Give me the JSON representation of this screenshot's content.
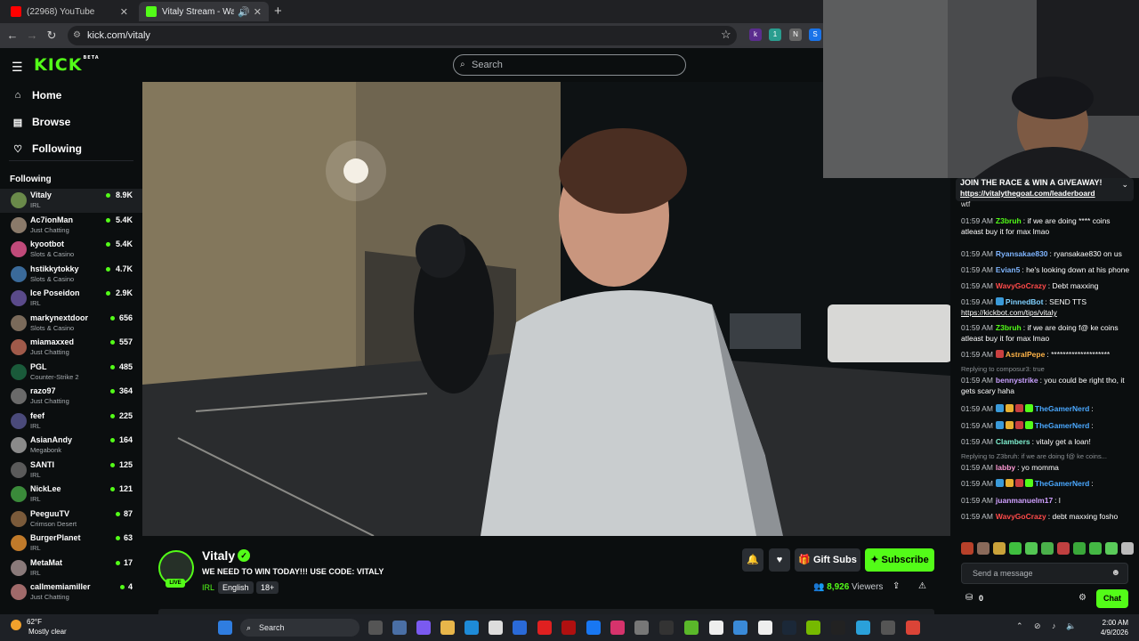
{
  "browser": {
    "tabs": [
      {
        "label": "(22968) YouTube"
      },
      {
        "label": "Vitaly Stream - Watch Live on Kick"
      }
    ],
    "url": "kick.com/vitaly"
  },
  "header": {
    "logo": "KICK",
    "logo_tag": "BETA",
    "search_placeholder": "Search"
  },
  "sidebar": {
    "nav": [
      {
        "label": "Home",
        "icon": "home-icon"
      },
      {
        "label": "Browse",
        "icon": "browse-icon"
      },
      {
        "label": "Following",
        "icon": "heart-icon"
      }
    ],
    "following_title": "Following",
    "following": [
      {
        "name": "Vitaly",
        "category": "IRL",
        "viewers": "8.9K",
        "color": "#6a8a4a"
      },
      {
        "name": "Ac7ionMan",
        "category": "Just Chatting",
        "viewers": "5.4K",
        "color": "#8a7a6a"
      },
      {
        "name": "kyootbot",
        "category": "Slots & Casino",
        "viewers": "5.4K",
        "color": "#c04a7a"
      },
      {
        "name": "hstikkytokky",
        "category": "Slots & Casino",
        "viewers": "4.7K",
        "color": "#3a6a9a"
      },
      {
        "name": "Ice Poseidon",
        "category": "IRL",
        "viewers": "2.9K",
        "color": "#5a4a8a"
      },
      {
        "name": "markynextdoor",
        "category": "Slots & Casino",
        "viewers": "656",
        "color": "#7a6a5a"
      },
      {
        "name": "miamaxxed",
        "category": "Just Chatting",
        "viewers": "557",
        "color": "#a05a4a"
      },
      {
        "name": "PGL",
        "category": "Counter-Strike 2",
        "viewers": "485",
        "color": "#1a5a3a"
      },
      {
        "name": "razo97",
        "category": "Just Chatting",
        "viewers": "364",
        "color": "#6a6a6a"
      },
      {
        "name": "feef",
        "category": "IRL",
        "viewers": "225",
        "color": "#4a4a7a"
      },
      {
        "name": "AsianAndy",
        "category": "Megabonk",
        "viewers": "164",
        "color": "#8a8a8a"
      },
      {
        "name": "SANTI",
        "category": "IRL",
        "viewers": "125",
        "color": "#5a5a5a"
      },
      {
        "name": "NickLee",
        "category": "IRL",
        "viewers": "121",
        "color": "#3a8a3a"
      },
      {
        "name": "PeeguuTV",
        "category": "Crimson Desert",
        "viewers": "87",
        "color": "#7a5a3a"
      },
      {
        "name": "BurgerPlanet",
        "category": "IRL",
        "viewers": "63",
        "color": "#c07a2a"
      },
      {
        "name": "MetaMat",
        "category": "IRL",
        "viewers": "17",
        "color": "#8a7a7a"
      },
      {
        "name": "callmemiamiller",
        "category": "Just Chatting",
        "viewers": "4",
        "color": "#a06a6a"
      }
    ]
  },
  "stream": {
    "name": "Vitaly",
    "live": "LIVE",
    "title": "WE NEED TO WIN TODAY!!! USE CODE: VITALY",
    "category": "IRL",
    "tags": [
      "English",
      "18+"
    ],
    "viewers": "8,926",
    "viewers_label": "Viewers",
    "gift_subs": "Gift Subs",
    "subscribe": "Subscribe"
  },
  "chat": {
    "pinned_title": "JOIN THE RACE & WIN A GIVEAWAY!",
    "pinned_link": "https://vitalythegoat.com/leaderboard",
    "truncated": "wtf",
    "messages": [
      {
        "time": "01:59 AM",
        "user": "Z3bruh",
        "color": "#53fc18",
        "text": "if we are doing **** coins atleast buy it for max lmao"
      },
      {
        "time": "01:59 AM",
        "user": "Ryansakae830",
        "color": "#7fb5ff",
        "text": "ryansakae830 on us"
      },
      {
        "time": "01:59 AM",
        "user": "Evian5",
        "color": "#7fb5ff",
        "text": "he's looking down at his phone"
      },
      {
        "time": "01:59 AM",
        "user": "WavyGoCrazy",
        "color": "#ff4a4a",
        "text": "Debt maxxing"
      },
      {
        "time": "01:59 AM",
        "user": "PinnedBot",
        "color": "#7fd0ff",
        "text": "SEND TTS",
        "link": "https://kickbot.com/tips/vitaly"
      },
      {
        "time": "01:59 AM",
        "user": "Z3bruh",
        "color": "#53fc18",
        "text": "if we are doing f@ ke coins atleast buy it for max lmao"
      },
      {
        "time": "01:59 AM",
        "user": "AstralPepe",
        "color": "#ffb347",
        "text": "********************"
      },
      {
        "reply": "Replying to composur3: true",
        "time": "01:59 AM",
        "user": "bennystrike",
        "color": "#c9a0ff",
        "text": "you could be right tho, it gets scary haha"
      },
      {
        "time": "01:59 AM",
        "user": "TheGamerNerd",
        "color": "#4aa8ff",
        "text": ""
      },
      {
        "time": "01:59 AM",
        "user": "TheGamerNerd",
        "color": "#4aa8ff",
        "text": ""
      },
      {
        "time": "01:59 AM",
        "user": "Clambers",
        "color": "#7ff0d0",
        "text": "vitaly get a loan!"
      },
      {
        "reply": "Replying to Z3bruh: if we are doing f@ ke coins...",
        "time": "01:59 AM",
        "user": "labby",
        "color": "#ff9ad5",
        "text": "yo momma"
      },
      {
        "time": "01:59 AM",
        "user": "TheGamerNerd",
        "color": "#4aa8ff",
        "text": ""
      },
      {
        "time": "01:59 AM",
        "user": "juanmanuelm17",
        "color": "#d0a0ff",
        "text": "l"
      },
      {
        "time": "01:59 AM",
        "user": "WavyGoCrazy",
        "color": "#ff4a4a",
        "text": "debt maxxing fosho"
      }
    ],
    "send_placeholder": "Send a message",
    "points": "0",
    "chat_button": "Chat"
  },
  "taskbar": {
    "temp": "62°F",
    "weather": "Mostly clear",
    "search": "Search",
    "time": "2:00 AM",
    "date": "4/9/2026"
  }
}
